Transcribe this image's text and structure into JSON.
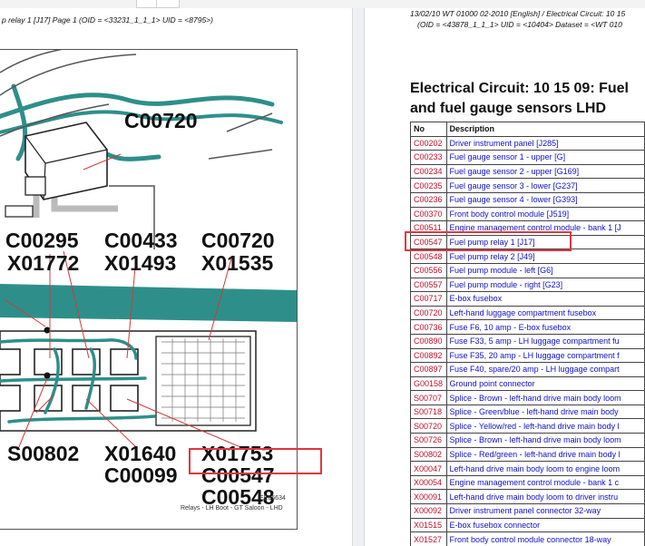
{
  "left_page": {
    "header": "p relay 1 [J17]  Page 1  (OID = <33231_1_1_1> UID = <8795>)",
    "diagram": {
      "id": "EE66634",
      "caption": "Relays - LH Boot - GT Saloon - LHD",
      "labels": {
        "top": "C00720",
        "row1": [
          "C00295",
          "C00433",
          "C00720"
        ],
        "row2": [
          "X01772",
          "X01493",
          "X01535"
        ],
        "bottom_left": "S00802",
        "bottom_mid1": "X01640",
        "bottom_mid2": "C00099",
        "bottom_right1": "X01753",
        "bottom_right2": "C00547",
        "bottom_right3": "C00548"
      },
      "colors": {
        "loom": "#2e8f8a",
        "highlight": "#e03640",
        "connector_line": "#d23a3a"
      }
    }
  },
  "right_page": {
    "header_line1": "13/02/10  WT 01000 02-2010 [English] / Electrical Circuit: 10 15",
    "header_line2": "(OID = <43878_1_1_1>  UID = <10404>  Dataset = <WT 010",
    "title_line1": "Electrical Circuit: 10 15 09: Fuel",
    "title_line2": "and fuel gauge sensors LHD",
    "table": {
      "headers": [
        "No",
        "Description"
      ],
      "rows": [
        [
          "C00202",
          "Driver instrument panel [J285]"
        ],
        [
          "C00233",
          "Fuel gauge sensor 1 - upper [G]"
        ],
        [
          "C00234",
          "Fuel gauge sensor 2 - upper [G169]"
        ],
        [
          "C00235",
          "Fuel gauge sensor 3 - lower [G237]"
        ],
        [
          "C00236",
          "Fuel gauge sensor 4 - lower [G393]"
        ],
        [
          "C00370",
          "Front body control module [J519]"
        ],
        [
          "C00511",
          "Engine management control module - bank 1 [J"
        ],
        [
          "C00547",
          "Fuel pump relay 1 [J17]"
        ],
        [
          "C00548",
          "Fuel pump relay 2 [J49]"
        ],
        [
          "C00556",
          "Fuel pump module - left [G6]"
        ],
        [
          "C00557",
          "Fuel pump module - right [G23]"
        ],
        [
          "C00717",
          "E-box fusebox"
        ],
        [
          "C00720",
          "Left-hand luggage compartment fusebox"
        ],
        [
          "C00736",
          "Fuse F6, 10 amp - E-box fusebox"
        ],
        [
          "C00890",
          "Fuse F33, 5 amp - LH luggage compartment fu"
        ],
        [
          "C00892",
          "Fuse F35, 20 amp - LH luggage compartment f"
        ],
        [
          "C00897",
          "Fuse F40, spare/20 amp - LH luggage compart"
        ],
        [
          "G00158",
          "Ground point connector"
        ],
        [
          "S00707",
          "Splice - Brown - left-hand drive main body loom"
        ],
        [
          "S00718",
          "Splice - Green/blue - left-hand drive main body"
        ],
        [
          "S00720",
          "Splice - Yellow/red - left-hand drive main body l"
        ],
        [
          "S00726",
          "Splice - Brown - left-hand drive main body loom"
        ],
        [
          "S00802",
          "Splice - Red/green - left-hand drive main body l"
        ],
        [
          "X00047",
          "Left-hand drive main body loom to engine loom"
        ],
        [
          "X00054",
          "Engine management control module - bank 1 c"
        ],
        [
          "X00091",
          "Left-hand drive main body loom to driver instru"
        ],
        [
          "X00092",
          "Driver instrument panel connector 32-way"
        ],
        [
          "X01515",
          "E-box fusebox connector"
        ],
        [
          "X01527",
          "Front body control module connector 18-way"
        ]
      ]
    }
  }
}
